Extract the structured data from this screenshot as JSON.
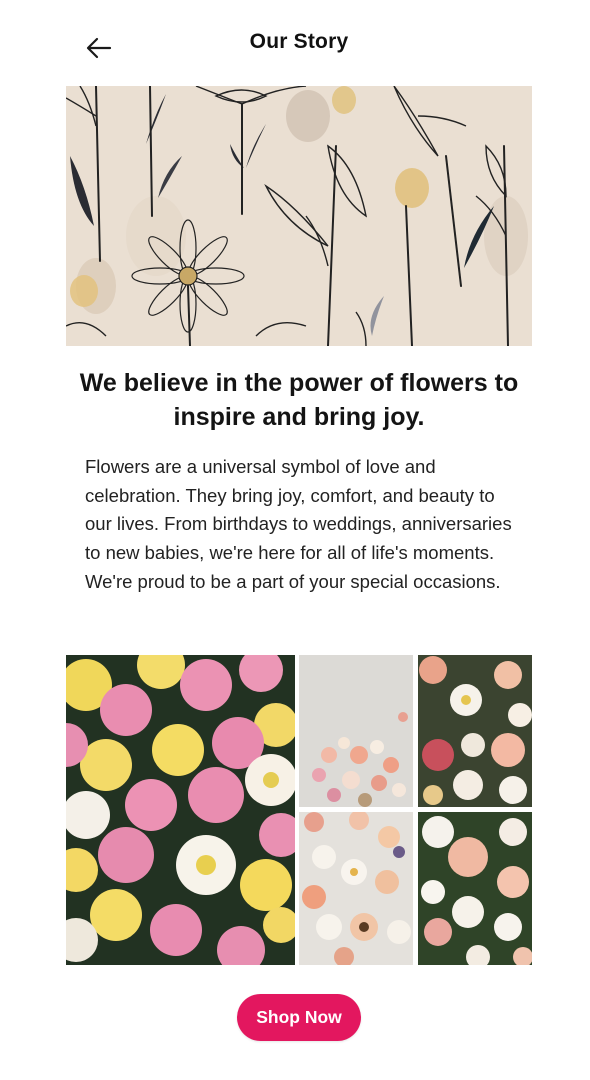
{
  "header": {
    "title": "Our Story",
    "back_icon": "arrow-left-icon"
  },
  "hero": {
    "image": "botanical line-art illustration of flowers"
  },
  "content": {
    "headline": "We believe in the power of flowers to inspire and bring joy.",
    "body": "Flowers are a universal symbol of love and celebration. They bring joy, comfort, and beauty to our lives. From birthdays to weddings, anniversaries to new babies, we're here for all of life's moments. We're proud to be a part of your special occasions."
  },
  "gallery": {
    "images": [
      "pink and yellow flower bouquet",
      "flowers in vase",
      "mixed flower arrangement",
      "daisies and roses bouquet",
      "white and peach flowers"
    ]
  },
  "cta": {
    "label": "Shop Now"
  },
  "colors": {
    "accent": "#e3175f",
    "hero_background": "#eadfd2"
  }
}
